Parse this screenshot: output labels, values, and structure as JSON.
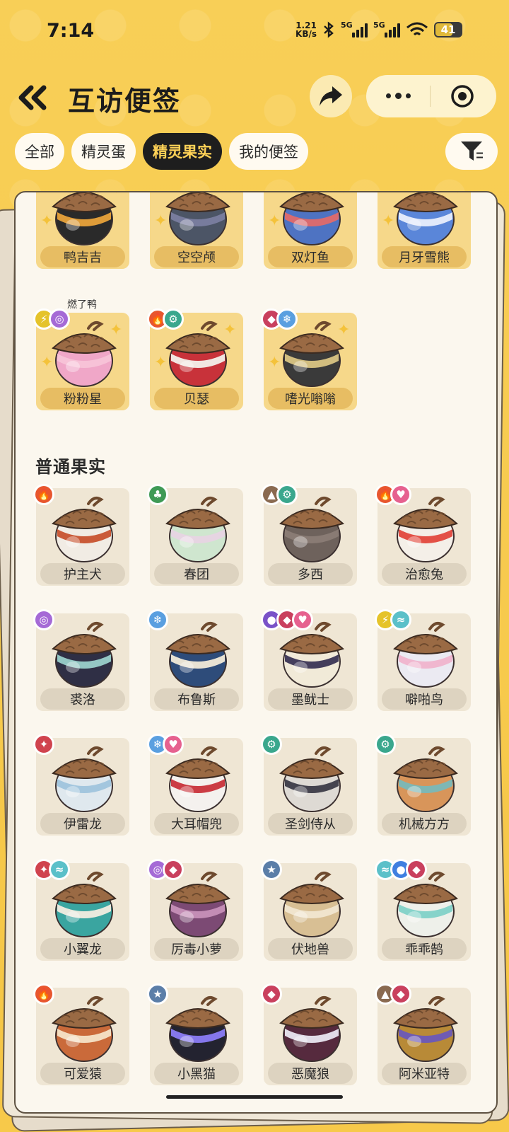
{
  "status_bar": {
    "time": "7:14",
    "net_speed_value": "1.21",
    "net_speed_unit": "KB/s",
    "sig1": "5G",
    "sig2": "5G",
    "battery": "41"
  },
  "header": {
    "title": "互访便签"
  },
  "tabs": [
    {
      "label": "全部",
      "active": false
    },
    {
      "label": "精灵蛋",
      "active": false
    },
    {
      "label": "精灵果实",
      "active": true
    },
    {
      "label": "我的便签",
      "active": false
    }
  ],
  "colors": {
    "background": "#f7c94a",
    "active_tab_bg": "#1e1e1e",
    "active_tab_text": "#ffd257"
  },
  "special_fruits": [
    {
      "name": "鸭吉吉",
      "badges": [],
      "body_color": "#2a2a2a",
      "band_color": "#e8a23a"
    },
    {
      "name": "空空颅",
      "badges": [],
      "body_color": "#4c5566",
      "band_color": "#7a7ea0"
    },
    {
      "name": "双灯鱼",
      "badges": [],
      "body_color": "#4e73c2",
      "band_color": "#e06a6a"
    },
    {
      "name": "月牙雪熊",
      "badges": [],
      "body_color": "#5a86d9",
      "band_color": "#e9eefc"
    },
    {
      "name": "粉粉星",
      "sub": "燃了鸭",
      "badges": [
        "electric",
        "psychic"
      ],
      "body_color": "#f0a7c8",
      "band_color": "#f7c3d8"
    },
    {
      "name": "贝瑟",
      "badges": [
        "fire",
        "mechanical"
      ],
      "body_color": "#c8323a",
      "band_color": "#f3f0ea"
    },
    {
      "name": "嗜光嗡嗡",
      "badges": [
        "demon",
        "ice"
      ],
      "body_color": "#3a3a3a",
      "band_color": "#d9c483"
    }
  ],
  "section": {
    "title": "普通果实"
  },
  "normal_fruits": [
    {
      "name": "护主犬",
      "badges": [
        "fire"
      ],
      "body_color": "#f1ece4",
      "band_color": "#c7532f"
    },
    {
      "name": "春团",
      "badges": [
        "grass"
      ],
      "body_color": "#cfe6cf",
      "band_color": "#e7d4e3"
    },
    {
      "name": "多西",
      "badges": [
        "ground",
        "mechanical"
      ],
      "body_color": "#6e625c",
      "band_color": "#8a7c75"
    },
    {
      "name": "治愈兔",
      "badges": [
        "fire",
        "cute"
      ],
      "body_color": "#f4efe8",
      "band_color": "#e2473d"
    },
    {
      "name": "裘洛",
      "badges": [
        "psychic"
      ],
      "body_color": "#2f2f45",
      "band_color": "#9ad0cb"
    },
    {
      "name": "布鲁斯",
      "badges": [
        "ice"
      ],
      "body_color": "#2e4c7a",
      "band_color": "#f2ead8"
    },
    {
      "name": "墨鱿士",
      "badges": [
        "ghost",
        "demon",
        "cute"
      ],
      "body_color": "#f1ead8",
      "band_color": "#3a3555"
    },
    {
      "name": "噼啪鸟",
      "badges": [
        "electric",
        "wind"
      ],
      "body_color": "#ebeaf2",
      "band_color": "#f0b4cc"
    },
    {
      "name": "伊雷龙",
      "badges": [
        "dragon"
      ],
      "body_color": "#dfe8ee",
      "band_color": "#9fc4dc"
    },
    {
      "name": "大耳帽兜",
      "badges": [
        "ice",
        "cute"
      ],
      "body_color": "#f4f1ee",
      "band_color": "#c8323a"
    },
    {
      "name": "圣剑侍从",
      "badges": [
        "mechanical"
      ],
      "body_color": "#dedad4",
      "band_color": "#3c3c48"
    },
    {
      "name": "机械方方",
      "badges": [
        "mechanical"
      ],
      "body_color": "#d8955a",
      "band_color": "#79b8b9"
    },
    {
      "name": "小翼龙",
      "badges": [
        "dragon",
        "wind"
      ],
      "body_color": "#3aa5a0",
      "band_color": "#f2ece0"
    },
    {
      "name": "厉毒小萝",
      "badges": [
        "psychic",
        "demon"
      ],
      "body_color": "#7c4a74",
      "band_color": "#c790b8"
    },
    {
      "name": "伏地兽",
      "badges": [
        "normal"
      ],
      "body_color": "#d8bf94",
      "band_color": "#f1e6d0"
    },
    {
      "name": "乖乖鹄",
      "badges": [
        "wind",
        "water",
        "demon"
      ],
      "body_color": "#eef0ea",
      "band_color": "#7fd1c8"
    },
    {
      "name": "可爱猿",
      "badges": [
        "fire"
      ],
      "body_color": "#ca6a3a",
      "band_color": "#f4e4c7"
    },
    {
      "name": "小黑猫",
      "badges": [
        "normal"
      ],
      "body_color": "#232330",
      "band_color": "#8b7cf5"
    },
    {
      "name": "恶魔狼",
      "badges": [
        "demon"
      ],
      "body_color": "#562a3e",
      "band_color": "#e9e6f0"
    },
    {
      "name": "阿米亚特",
      "badges": [
        "ground",
        "demon"
      ],
      "body_color": "#b88a37",
      "band_color": "#6a58b8"
    }
  ]
}
